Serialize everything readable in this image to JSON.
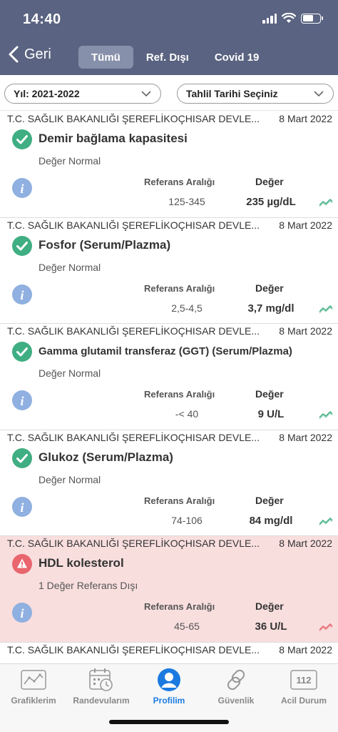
{
  "status_bar": {
    "time": "14:40"
  },
  "navbar": {
    "back_label": "Geri",
    "tabs": [
      {
        "label": "Tümü",
        "active": true
      },
      {
        "label": "Ref. Dışı",
        "active": false
      },
      {
        "label": "Covid 19",
        "active": false
      }
    ]
  },
  "filters": {
    "year": "Yıl: 2021-2022",
    "date": "Tahlil Tarihi Seçiniz"
  },
  "list": {
    "ref_header": "Referans Aralığı",
    "value_header": "Değer",
    "items": [
      {
        "hospital": "T.C. SAĞLIK BAKANLIĞI ŞEREFLİKOÇHISAR DEVLE...",
        "date": "8 Mart 2022",
        "test": "Demir bağlama kapasitesi",
        "status": "Değer Normal",
        "ref": "125-345",
        "value": "235 µg/dL",
        "state": "normal"
      },
      {
        "hospital": "T.C. SAĞLIK BAKANLIĞI ŞEREFLİKOÇHISAR DEVLE...",
        "date": "8 Mart 2022",
        "test": "Fosfor (Serum/Plazma)",
        "status": "Değer Normal",
        "ref": "2,5-4,5",
        "value": "3,7 mg/dl",
        "state": "normal"
      },
      {
        "hospital": "T.C. SAĞLIK BAKANLIĞI ŞEREFLİKOÇHISAR DEVLE...",
        "date": "8 Mart 2022",
        "test": "Gamma glutamil transferaz (GGT) (Serum/Plazma)",
        "status": "Değer Normal",
        "ref": "-< 40",
        "value": "9 U/L",
        "state": "normal"
      },
      {
        "hospital": "T.C. SAĞLIK BAKANLIĞI ŞEREFLİKOÇHISAR DEVLE...",
        "date": "8 Mart 2022",
        "test": "Glukoz (Serum/Plazma)",
        "status": "Değer Normal",
        "ref": "74-106",
        "value": "84 mg/dl",
        "state": "normal"
      },
      {
        "hospital": "T.C. SAĞLIK BAKANLIĞI ŞEREFLİKOÇHISAR DEVLE...",
        "date": "8 Mart 2022",
        "test": "HDL kolesterol",
        "status": "1 Değer Referans Dışı",
        "ref": "45-65",
        "value": "36 U/L",
        "state": "alert"
      },
      {
        "hospital": "T.C. SAĞLIK BAKANLIĞI ŞEREFLİKOÇHISAR DEVLE...",
        "date": "8 Mart 2022"
      }
    ]
  },
  "tabbar": {
    "tabs": [
      {
        "label": "Grafiklerim",
        "icon": "chart-icon"
      },
      {
        "label": "Randevularım",
        "icon": "calendar-icon"
      },
      {
        "label": "Profilim",
        "icon": "profile-icon",
        "active": true
      },
      {
        "label": "Güvenlik",
        "icon": "link-icon"
      },
      {
        "label": "Acil Durum",
        "icon": "emergency-icon",
        "badge": "112"
      }
    ]
  },
  "colors": {
    "header": "#5a6381",
    "normal": "#3fae82",
    "alert": "#e9666e",
    "alert_bg": "#f9dede",
    "info": "#8fb0e0",
    "active_tab": "#1a7ae0"
  }
}
